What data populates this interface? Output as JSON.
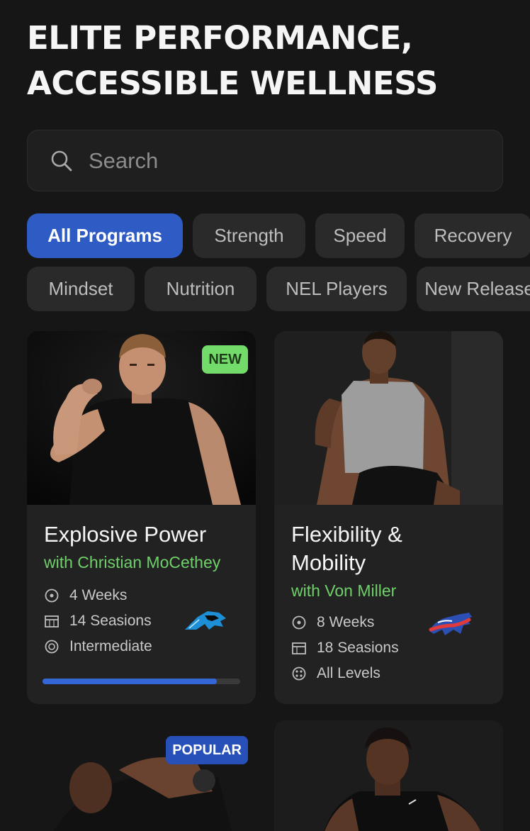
{
  "header": {
    "title": "ELITE PERFORMANCE, ACCESSIBLE WELLNESS"
  },
  "search": {
    "placeholder": "Search",
    "icon": "search-icon"
  },
  "filters": {
    "active": "All Programs",
    "row1": [
      "All Programs",
      "Strength",
      "Speed",
      "Recovery"
    ],
    "row2": [
      "Mindset",
      "Nutrition",
      "NEL Players",
      "New Releases"
    ]
  },
  "programs": [
    {
      "title": "Explosive Power",
      "coach": "with Christian MoCethey",
      "badge": "NEW",
      "duration": "4 Weeks",
      "sessions": "14 Seasions",
      "level": "Intermediate",
      "progress": 0.88,
      "team_logo": "panther-logo"
    },
    {
      "title": "Flexibility & Mobility",
      "coach": "with Von Miller",
      "badge": "",
      "duration": "8 Weeks",
      "sessions": "18 Seasions",
      "level": "All Levels",
      "team_logo": "bison-logo"
    },
    {
      "badge": "POPULAR"
    },
    {
      "badge": ""
    }
  ],
  "colors": {
    "accent": "#2f5cc4",
    "coach_green": "#6fd06a",
    "new_badge": "#73db69",
    "background": "#161616"
  }
}
